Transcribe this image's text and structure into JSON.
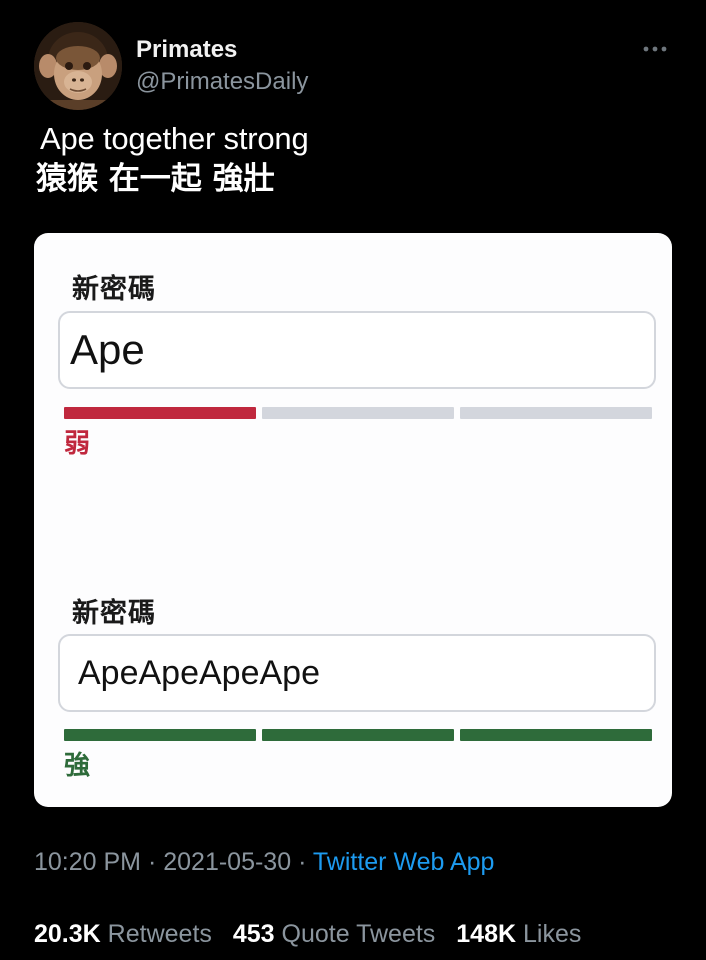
{
  "author": {
    "display_name": "Primates",
    "handle": "@PrimatesDaily"
  },
  "menu": {
    "icon": "more-horizontal-icon"
  },
  "tweet": {
    "line1": "Ape together strong",
    "line2": "猿猴 在一起 強壯"
  },
  "media": {
    "weak_example": {
      "label": "新密碼",
      "value": "Ape",
      "strength_text": "弱",
      "strength_color": "#c0283e",
      "meter_filled_segments": 1,
      "meter_total_segments": 3
    },
    "strong_example": {
      "label": "新密碼",
      "value": "ApeApeApeApe",
      "strength_text": "強",
      "strength_color": "#2e6b3a",
      "meter_filled_segments": 3,
      "meter_total_segments": 3
    },
    "meter_empty_color": "#d3d6dd"
  },
  "meta": {
    "time": "10:20 PM",
    "sep1": " · ",
    "date": "2021-05-30",
    "sep2": " · ",
    "source": "Twitter Web App"
  },
  "stats": {
    "retweets_count": "20.3K",
    "retweets_label": "Retweets",
    "quotes_count": "453",
    "quotes_label": "Quote Tweets",
    "likes_count": "148K",
    "likes_label": "Likes"
  },
  "colors": {
    "background": "#000000",
    "link_blue": "#1d9bf0",
    "muted_gray": "#8b959e"
  }
}
